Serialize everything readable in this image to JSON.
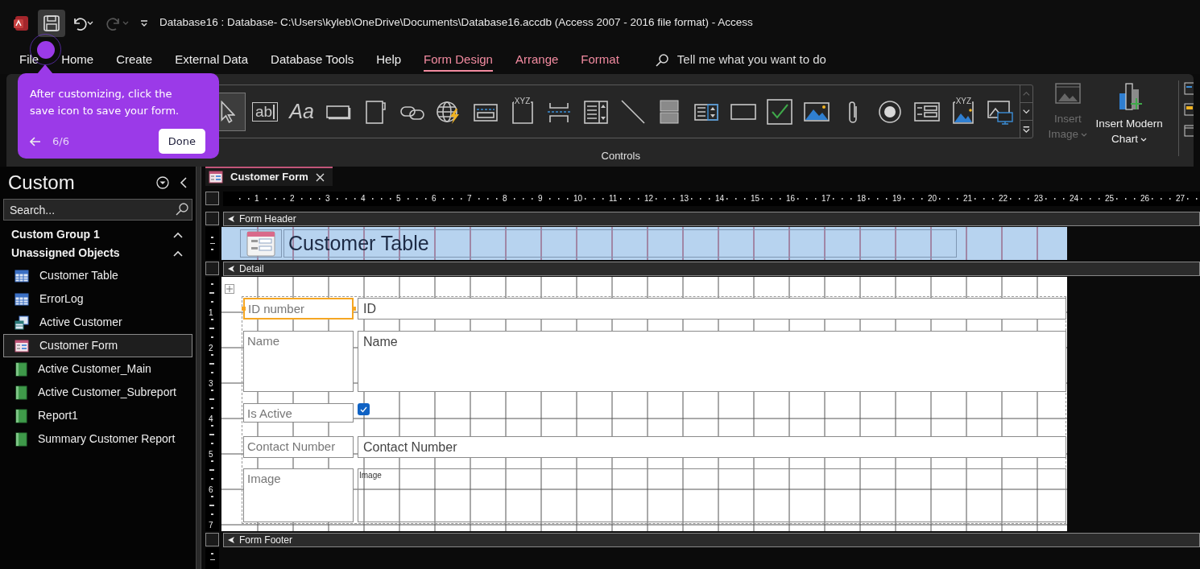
{
  "title_bar": {
    "title": "Database16 : Database- C:\\Users\\kyleb\\OneDrive\\Documents\\Database16.accdb (Access 2007 - 2016 file format)  -  Access"
  },
  "ribbon_tabs": [
    {
      "label": "File",
      "selected": false,
      "contextual": false
    },
    {
      "label": "Home",
      "selected": false,
      "contextual": false
    },
    {
      "label": "Create",
      "selected": false,
      "contextual": false
    },
    {
      "label": "External Data",
      "selected": false,
      "contextual": false
    },
    {
      "label": "Database Tools",
      "selected": false,
      "contextual": false
    },
    {
      "label": "Help",
      "selected": false,
      "contextual": false
    },
    {
      "label": "Form Design",
      "selected": true,
      "contextual": true
    },
    {
      "label": "Arrange",
      "selected": false,
      "contextual": true
    },
    {
      "label": "Format",
      "selected": false,
      "contextual": true
    }
  ],
  "tell_me": {
    "placeholder": "Tell me what you want to do"
  },
  "ribbon": {
    "group_label": "Controls",
    "tools": [
      {
        "kind": "select",
        "selected": true
      },
      {
        "kind": "textbox",
        "glyph": "ab",
        "selected": false
      },
      {
        "kind": "label",
        "glyph": "Aa",
        "selected": false
      },
      {
        "kind": "button",
        "selected": false
      },
      {
        "kind": "tab",
        "selected": false
      },
      {
        "kind": "hyperlink",
        "selected": false
      },
      {
        "kind": "web",
        "selected": false
      },
      {
        "kind": "navigation",
        "selected": false
      },
      {
        "kind": "option-group",
        "glyph": "XYZ",
        "selected": false
      },
      {
        "kind": "page-break",
        "selected": false
      },
      {
        "kind": "combo",
        "selected": false
      },
      {
        "kind": "line",
        "selected": false
      },
      {
        "kind": "toggle",
        "selected": false
      },
      {
        "kind": "listbox",
        "selected": false
      },
      {
        "kind": "rectangle",
        "selected": false
      },
      {
        "kind": "checkbox",
        "selected": false
      },
      {
        "kind": "image",
        "selected": false
      },
      {
        "kind": "attachment",
        "selected": false
      },
      {
        "kind": "option",
        "selected": false
      },
      {
        "kind": "subform",
        "selected": false
      },
      {
        "kind": "bound-frame",
        "glyph": "XYZ",
        "selected": false
      },
      {
        "kind": "unbound-frame",
        "selected": false
      }
    ],
    "buttons": [
      {
        "label": "Insert Image",
        "disabled": true
      },
      {
        "label": "Insert Modern Chart",
        "disabled": false
      }
    ]
  },
  "tour": {
    "text": "After customizing, click the save icon to save your form.",
    "step": "6/6",
    "button": "Done"
  },
  "nav_pane": {
    "title": "Custom",
    "search_placeholder": "Search...",
    "groups": [
      {
        "label": "Custom Group 1",
        "expanded": true
      },
      {
        "label": "Unassigned Objects",
        "expanded": true,
        "items": [
          {
            "label": "Customer Table",
            "kind": "table",
            "selected": false
          },
          {
            "label": "ErrorLog",
            "kind": "table",
            "selected": false
          },
          {
            "label": "Active Customer",
            "kind": "query",
            "selected": false
          },
          {
            "label": "Customer Form",
            "kind": "form",
            "selected": true
          },
          {
            "label": "Active Customer_Main",
            "kind": "report",
            "selected": false
          },
          {
            "label": "Active Customer_Subreport",
            "kind": "report",
            "selected": false
          },
          {
            "label": "Report1",
            "kind": "report",
            "selected": false
          },
          {
            "label": "Summary Customer Report",
            "kind": "report",
            "selected": false
          }
        ]
      }
    ]
  },
  "document_tab": {
    "label": "Customer Form"
  },
  "ruler": {
    "horizontal": [
      "1",
      "2",
      "3",
      "4",
      "5",
      "6",
      "7",
      "8",
      "9",
      "10",
      "11",
      "12",
      "13",
      "14",
      "15",
      "16",
      "17",
      "18",
      "19",
      "20",
      "21",
      "22",
      "23",
      "24",
      "25",
      "26",
      "27"
    ],
    "vertical": [
      "1",
      "2",
      "3",
      "4",
      "5",
      "6",
      "7"
    ]
  },
  "form_header": {
    "label": "Form Header",
    "title": "Customer Table"
  },
  "detail": {
    "label": "Detail",
    "controls": [
      {
        "kind": "textbox",
        "label": "ID number",
        "value": "ID",
        "selected": true
      },
      {
        "kind": "memo",
        "label": "Name",
        "value": "Name",
        "selected": false
      },
      {
        "kind": "checkbox",
        "label": "Is Active",
        "checked": true,
        "selected": false
      },
      {
        "kind": "textbox",
        "label": "Contact Number",
        "value": "Contact Number",
        "selected": false
      },
      {
        "kind": "image",
        "label": "Image",
        "value": "Image",
        "selected": false
      }
    ]
  },
  "form_footer": {
    "label": "Form Footer"
  }
}
